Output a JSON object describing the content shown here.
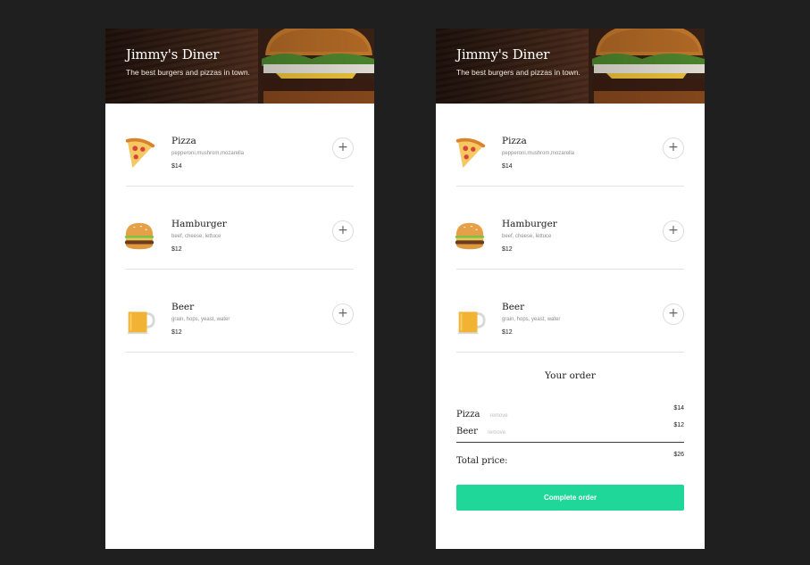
{
  "left": {
    "header": {
      "title": "Jimmy's Diner",
      "subtitle": "The best burgers and pizzas in town."
    },
    "menu": [
      {
        "name": "Pizza",
        "ingredients": "pepperoni,mushrom,mozarella",
        "price": "$14",
        "icon": "pizza-icon",
        "add_label": "+"
      },
      {
        "name": "Hamburger",
        "ingredients": "beef, cheese, lettuce",
        "price": "$12",
        "icon": "hamburger-icon",
        "add_label": "+"
      },
      {
        "name": "Beer",
        "ingredients": "grain, hops, yeast, water",
        "price": "$12",
        "icon": "beer-icon",
        "add_label": "+"
      }
    ]
  },
  "right": {
    "header": {
      "title": "Jimmy's Diner",
      "subtitle": "The best burgers and pizzas in town."
    },
    "menu": [
      {
        "name": "Pizza",
        "ingredients": "pepperoni,mushrom,mozarella",
        "price": "$14",
        "icon": "pizza-icon",
        "add_label": "+"
      },
      {
        "name": "Hamburger",
        "ingredients": "beef, cheese, lettuce",
        "price": "$12",
        "icon": "hamburger-icon",
        "add_label": "+"
      },
      {
        "name": "Beer",
        "ingredients": "grain, hops, yeast, water",
        "price": "$12",
        "icon": "beer-icon",
        "add_label": "+"
      }
    ],
    "order": {
      "title": "Your order",
      "items": [
        {
          "name": "Pizza",
          "remove_label": "remove",
          "price": "$14"
        },
        {
          "name": "Beer",
          "remove_label": "remove",
          "price": "$12"
        }
      ],
      "total_label": "Total price:",
      "total_value": "$26",
      "complete_label": "Complete order"
    }
  },
  "colors": {
    "background": "#1f1f1f",
    "accent": "#1ed799",
    "card": "#ffffff"
  }
}
